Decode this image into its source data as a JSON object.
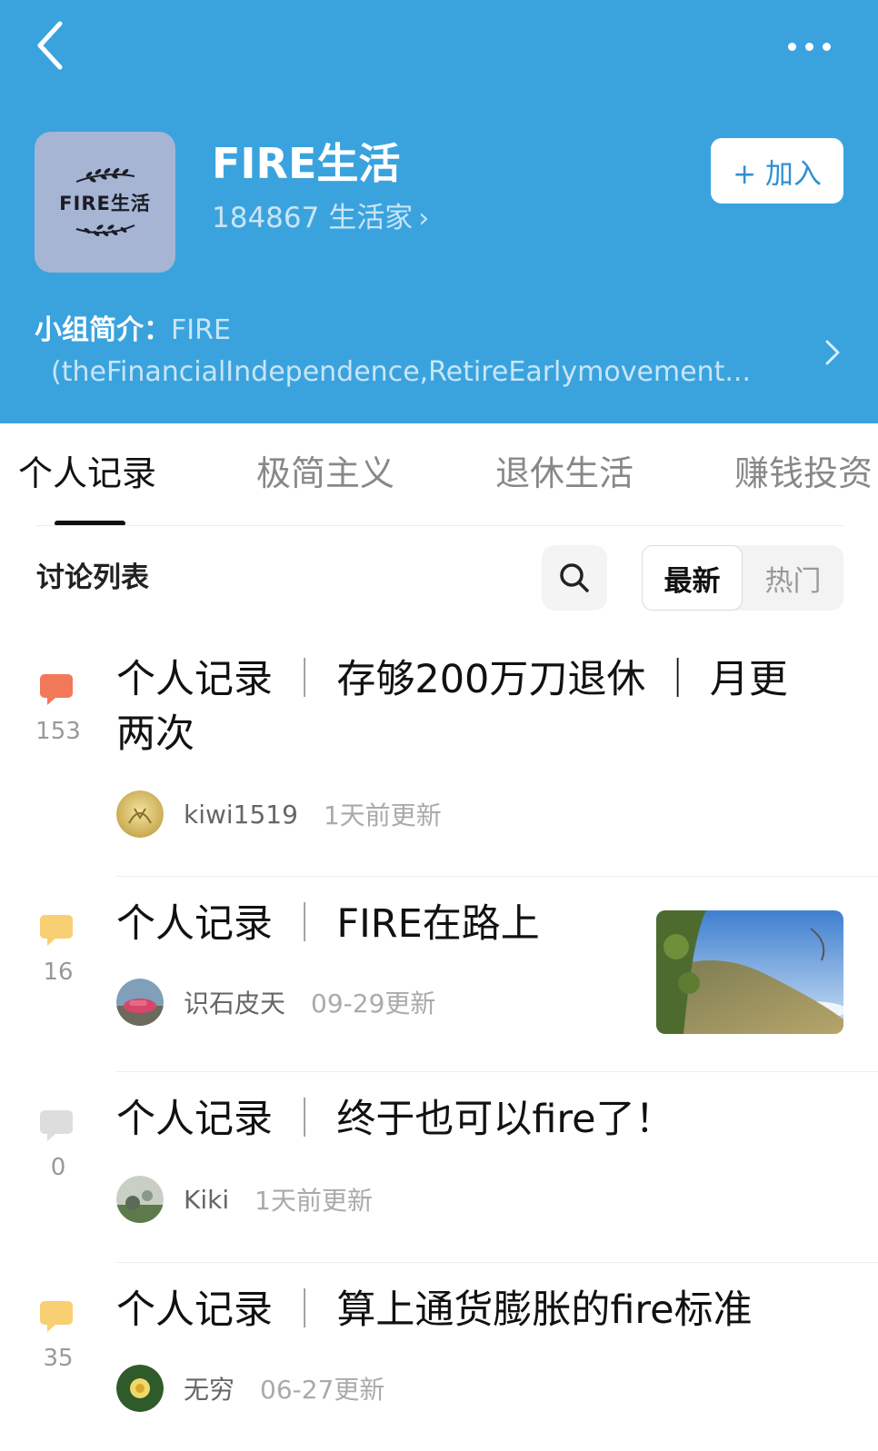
{
  "header": {
    "group_name": "FIRE生活",
    "member_count": "184867 生活家",
    "join_label": "+ 加入",
    "intro_label": "小组简介：",
    "intro_text_line1": "FIRE",
    "intro_text_line2": "(theFinancialIndependence,RetireEarlymovement...",
    "logo_text": "FIRE生活",
    "bg_color": "#3aa3de"
  },
  "tabs": [
    {
      "label": "个人记录",
      "active": true
    },
    {
      "label": "极简主义",
      "active": false
    },
    {
      "label": "退休生活",
      "active": false
    },
    {
      "label": "赚钱投资",
      "active": false
    }
  ],
  "toolbar": {
    "list_title": "讨论列表",
    "sort_latest": "最新",
    "sort_hot": "热门"
  },
  "posts": [
    {
      "title_prefix": "个人记录",
      "title_rest": "存够200万刀退休 ｜ 月更两次",
      "comment_count": "153",
      "author": "kiwi1519",
      "time": "1天前更新",
      "bubble_color": "#f2785a"
    },
    {
      "title_prefix": "个人记录",
      "title_rest": "FIRE在路上",
      "comment_count": "16",
      "author": "识石皮天",
      "time": "09-29更新",
      "bubble_color": "#f8cf72"
    },
    {
      "title_prefix": "个人记录",
      "title_rest": "终于也可以fire了！",
      "comment_count": "0",
      "author": "Kiki",
      "time": "1天前更新",
      "bubble_color": "#dddddd"
    },
    {
      "title_prefix": "个人记录",
      "title_rest": "算上通货膨胀的fire标准",
      "comment_count": "35",
      "author": "无穷",
      "time": "06-27更新",
      "bubble_color": "#f8cf72"
    }
  ]
}
